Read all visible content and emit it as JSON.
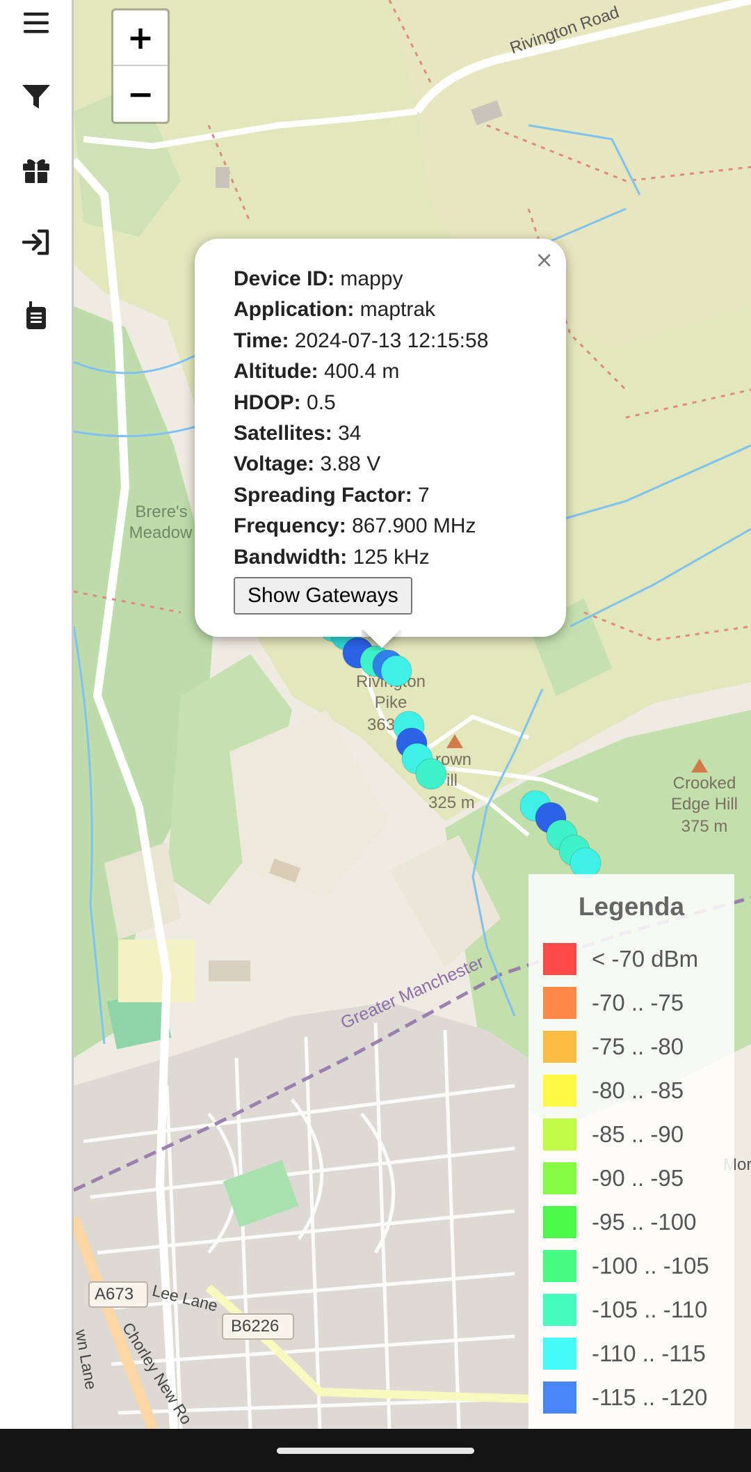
{
  "sidebar": {
    "items": [
      {
        "icon": "menu-icon"
      },
      {
        "icon": "filter-icon"
      },
      {
        "icon": "gift-icon"
      },
      {
        "icon": "login-icon"
      },
      {
        "icon": "walkie-talkie-icon"
      }
    ]
  },
  "zoom": {
    "in_label": "+",
    "out_label": "−"
  },
  "map_labels": {
    "rivington_road": "Rivington Road",
    "breres_meadow_1": "Brere's",
    "breres_meadow_2": "Meadow",
    "rivington_pike_1": "Rivington",
    "rivington_pike_2": "Pike",
    "rivington_pike_3": "363",
    "crown_hill_1": "rown",
    "crown_hill_2": "ill",
    "crown_hill_3": "325 m",
    "crooked_1": "Crooked",
    "crooked_2": "Edge Hill",
    "crooked_3": "375 m",
    "greater_manchester": "Greater Manchester",
    "a673": "A673",
    "b6226": "B6226",
    "lee_lane": "Lee Lane",
    "chorley_new_road": "Chorley New Ro",
    "wn_lane": "wn Lane",
    "mor": "Mor"
  },
  "popup": {
    "close": "×",
    "rows": [
      {
        "label": "Device ID:",
        "value": "mappy"
      },
      {
        "label": "Application:",
        "value": "maptrak"
      },
      {
        "label": "Time:",
        "value": "2024-07-13 12:15:58"
      },
      {
        "label": "Altitude:",
        "value": "400.4 m"
      },
      {
        "label": "HDOP:",
        "value": "0.5"
      },
      {
        "label": "Satellites:",
        "value": "34"
      },
      {
        "label": "Voltage:",
        "value": "3.88 V"
      },
      {
        "label": "Spreading Factor:",
        "value": "7"
      },
      {
        "label": "Frequency:",
        "value": "867.900 MHz"
      },
      {
        "label": "Bandwidth:",
        "value": "125 kHz"
      }
    ],
    "button_label": "Show Gateways"
  },
  "legend": {
    "title": "Legenda",
    "items": [
      {
        "label": "< -70 dBm",
        "color": "#ff4a4a"
      },
      {
        "label": "-70 .. -75",
        "color": "#ff8a47"
      },
      {
        "label": "-75 .. -80",
        "color": "#ffbc45"
      },
      {
        "label": "-80 .. -85",
        "color": "#fffa45"
      },
      {
        "label": "-85 .. -90",
        "color": "#c2fb45"
      },
      {
        "label": "-90 .. -95",
        "color": "#86fb45"
      },
      {
        "label": "-95 .. -100",
        "color": "#4afb4a"
      },
      {
        "label": "-100 .. -105",
        "color": "#47fb83"
      },
      {
        "label": "-105 .. -110",
        "color": "#47fbbf"
      },
      {
        "label": "-110 .. -115",
        "color": "#47fbf9"
      },
      {
        "label": "-115 .. -120",
        "color": "#4a86fb"
      }
    ]
  },
  "colors": {
    "forest": "#c2dfb0",
    "moor": "#dfe6b8",
    "water": "#7fc1f0",
    "track_point_dark": "#2b63e8",
    "track_point_light": "#3ff0e6"
  }
}
